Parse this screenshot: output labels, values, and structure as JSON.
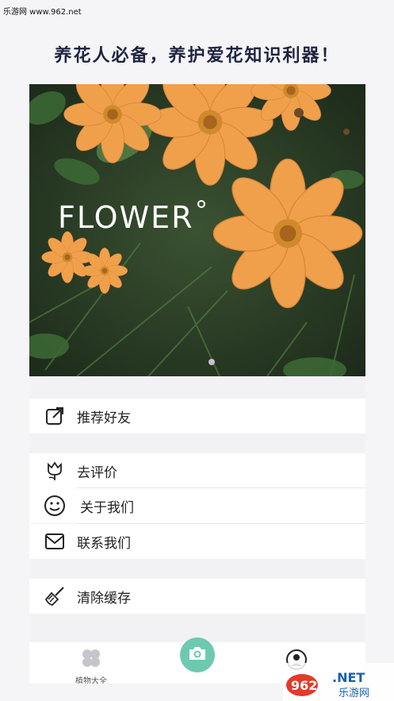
{
  "watermark_top": "乐游网 www.962.net",
  "headline": "养花人必备，养护爱花知识利器！",
  "hero": {
    "title": "FLOWER"
  },
  "menu": {
    "recommend": "推荐好友",
    "rate": "去评价",
    "about": "关于我们",
    "contact": "联系我们",
    "clear_cache": "清除缓存"
  },
  "tabbar": {
    "plants_label": "植物大全"
  },
  "watermark_badge": {
    "brand": "962",
    "tld": ".NET",
    "cn": "乐游网"
  },
  "colors": {
    "accent": "#6dc9b0",
    "petal": "#f0a04b",
    "leaf": "#2e4a2a"
  },
  "icons": [
    "share-icon",
    "tulip-icon",
    "smile-icon",
    "mail-icon",
    "broom-icon",
    "clover-icon",
    "camera-icon",
    "user-icon"
  ]
}
